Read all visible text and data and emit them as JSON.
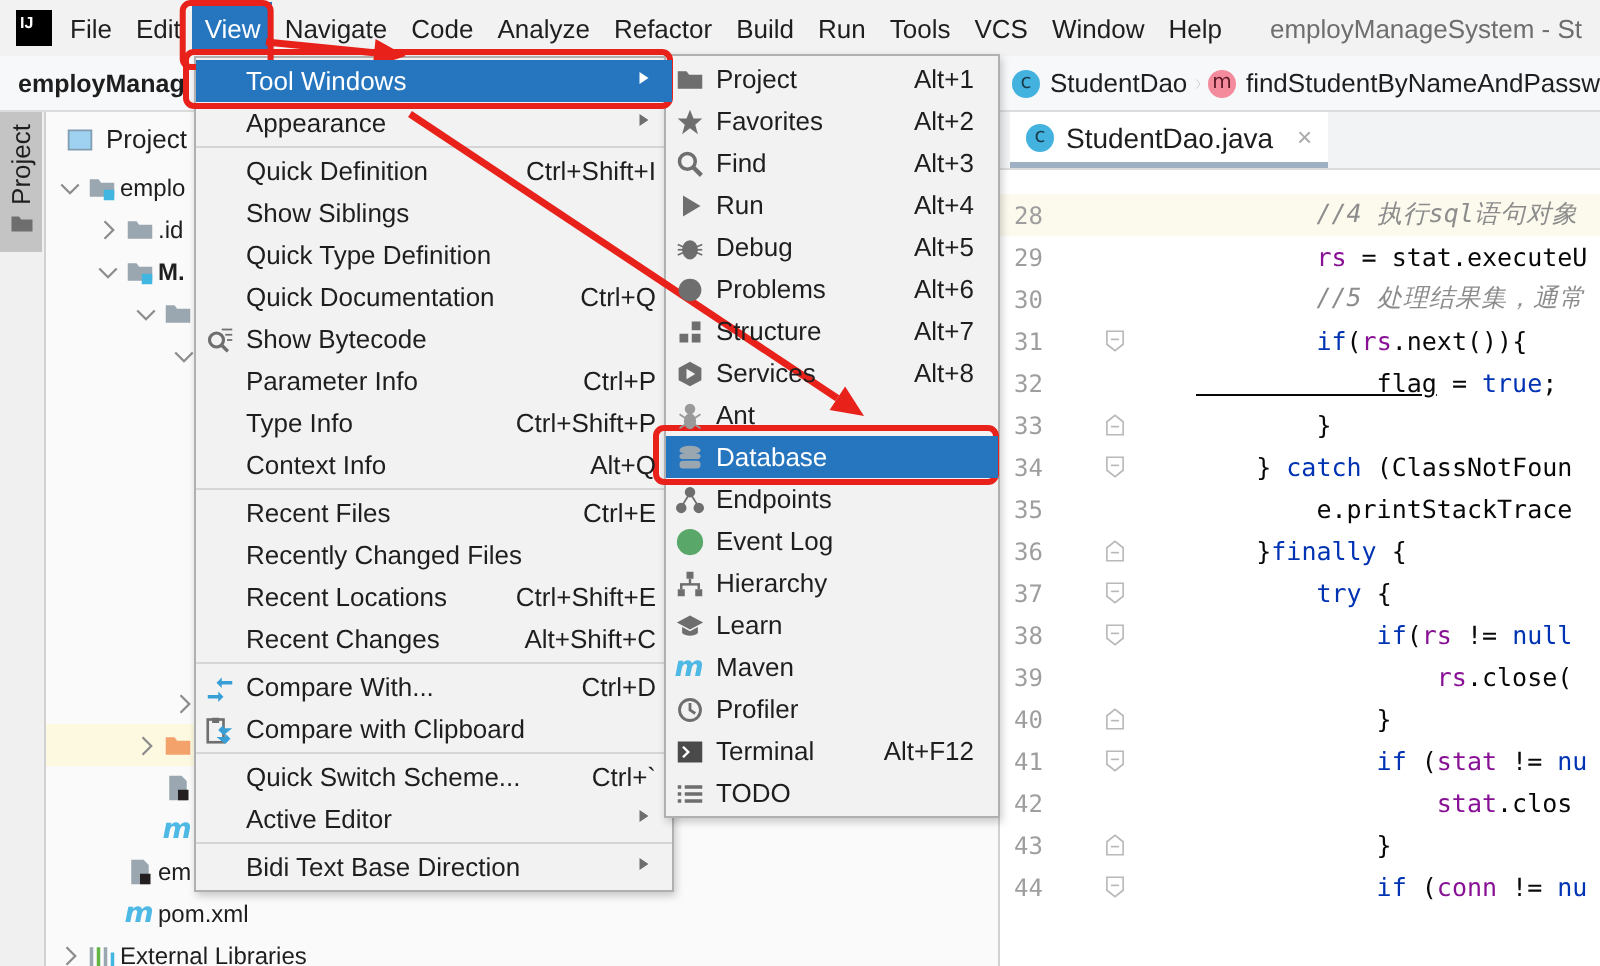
{
  "menubar": {
    "logo_text": "IJ",
    "items": [
      {
        "label": "File",
        "selected": false,
        "outlined": false
      },
      {
        "label": "Edit",
        "selected": false,
        "outlined": false
      },
      {
        "label": "View",
        "selected": true,
        "outlined": true
      },
      {
        "label": "Navigate",
        "selected": false,
        "outlined": false
      },
      {
        "label": "Code",
        "selected": false,
        "outlined": false
      },
      {
        "label": "Analyze",
        "selected": false,
        "outlined": false
      },
      {
        "label": "Refactor",
        "selected": false,
        "outlined": false
      },
      {
        "label": "Build",
        "selected": false,
        "outlined": false
      },
      {
        "label": "Run",
        "selected": false,
        "outlined": false
      },
      {
        "label": "Tools",
        "selected": false,
        "outlined": false
      },
      {
        "label": "VCS",
        "selected": false,
        "outlined": false
      },
      {
        "label": "Window",
        "selected": false,
        "outlined": false
      },
      {
        "label": "Help",
        "selected": false,
        "outlined": false
      }
    ],
    "title": "employManageSystem - St"
  },
  "navbar": {
    "project_name": "employManag"
  },
  "tool_stripe": [
    {
      "label": "Project",
      "selected": true
    }
  ],
  "project_panel": {
    "title": "Project",
    "tree": [
      {
        "label": "emplo",
        "kind": "module",
        "expanded": true,
        "selected": false,
        "children": [
          {
            "label": ".id",
            "kind": "folder",
            "expanded": false,
            "selected": false
          },
          {
            "label": "M.",
            "bold": true,
            "kind": "module",
            "expanded": true,
            "selected": false,
            "children": [
              {
                "kind": "folder",
                "expanded": true,
                "selected": false,
                "children": [
                  {
                    "expanded": true,
                    "selected": false
                  },
                  {
                    "expanded": false,
                    "selected": false
                  }
                ]
              },
              {
                "kind": "folder-orange",
                "expanded": false,
                "selected": true
              },
              {
                "kind": "file",
                "selected": false
              },
              {
                "kind": "maven",
                "icon_glyph": "m",
                "selected": false
              }
            ]
          },
          {
            "label": "em",
            "kind": "file",
            "selected": false
          },
          {
            "label": "pom.xml",
            "kind": "maven",
            "icon_glyph": "m",
            "selected": false
          }
        ]
      },
      {
        "label": "External Libraries",
        "kind": "libraries",
        "expanded": false,
        "selected": false
      }
    ]
  },
  "breadcrumbs": [
    {
      "kind": "class",
      "icon_glyph": "c",
      "label": "StudentDao"
    },
    {
      "kind": "method",
      "icon_glyph": "m",
      "label": "findStudentByNameAndPassw"
    }
  ],
  "editor": {
    "tabs": [
      {
        "label": "StudentDao.java",
        "icon_glyph": "c",
        "close": "×",
        "selected": true
      }
    ],
    "lines": [
      {
        "number": "28",
        "current": true,
        "kind": "plain",
        "segments": [
          {
            "kind": "comment",
            "text": "        //4 执行sql语句对象"
          }
        ]
      },
      {
        "number": "29",
        "current": false,
        "kind": "plain",
        "segments": [
          {
            "kind": "field",
            "text": "        rs"
          },
          {
            "kind": "plain",
            "text": " = stat.executeU"
          }
        ]
      },
      {
        "number": "30",
        "current": false,
        "kind": "plain",
        "segments": [
          {
            "kind": "comment",
            "text": "        //5 处理结果集，通常"
          }
        ]
      },
      {
        "number": "31",
        "current": false,
        "kind": "fold-start",
        "segments": [
          {
            "kind": "keyword",
            "text": "        if"
          },
          {
            "kind": "plain",
            "text": "("
          },
          {
            "kind": "field",
            "text": "rs"
          },
          {
            "kind": "plain",
            "text": ".next()){"
          }
        ]
      },
      {
        "number": "32",
        "current": false,
        "kind": "plain",
        "segments": [
          {
            "kind": "var",
            "text": "            flag"
          },
          {
            "kind": "plain",
            "text": " = "
          },
          {
            "kind": "keyword",
            "text": "true"
          },
          {
            "kind": "plain",
            "text": ";"
          }
        ]
      },
      {
        "number": "33",
        "current": false,
        "kind": "fold-end",
        "segments": [
          {
            "kind": "plain",
            "text": "        }"
          }
        ]
      },
      {
        "number": "34",
        "current": false,
        "kind": "fold-start",
        "segments": [
          {
            "kind": "plain",
            "text": "    } "
          },
          {
            "kind": "keyword",
            "text": "catch"
          },
          {
            "kind": "plain",
            "text": " (ClassNotFoun"
          }
        ]
      },
      {
        "number": "35",
        "current": false,
        "kind": "plain",
        "segments": [
          {
            "kind": "plain",
            "text": "        e.printStackTrace"
          }
        ]
      },
      {
        "number": "36",
        "current": false,
        "kind": "fold-end",
        "segments": [
          {
            "kind": "plain",
            "text": "    }"
          },
          {
            "kind": "keyword",
            "text": "finally"
          },
          {
            "kind": "plain",
            "text": " {"
          }
        ]
      },
      {
        "number": "37",
        "current": false,
        "kind": "fold-start",
        "segments": [
          {
            "kind": "keyword",
            "text": "        try"
          },
          {
            "kind": "plain",
            "text": " {"
          }
        ]
      },
      {
        "number": "38",
        "current": false,
        "kind": "fold-start",
        "segments": [
          {
            "kind": "keyword",
            "text": "            if"
          },
          {
            "kind": "plain",
            "text": "("
          },
          {
            "kind": "field",
            "text": "rs"
          },
          {
            "kind": "plain",
            "text": " != "
          },
          {
            "kind": "keyword",
            "text": "null"
          }
        ]
      },
      {
        "number": "39",
        "current": false,
        "kind": "plain",
        "segments": [
          {
            "kind": "field",
            "text": "                rs"
          },
          {
            "kind": "plain",
            "text": ".close("
          }
        ]
      },
      {
        "number": "40",
        "current": false,
        "kind": "fold-end",
        "segments": [
          {
            "kind": "plain",
            "text": "            }"
          }
        ]
      },
      {
        "number": "41",
        "current": false,
        "kind": "fold-start",
        "segments": [
          {
            "kind": "keyword",
            "text": "            if"
          },
          {
            "kind": "plain",
            "text": " ("
          },
          {
            "kind": "field",
            "text": "stat"
          },
          {
            "kind": "plain",
            "text": " != "
          },
          {
            "kind": "keyword",
            "text": "nu"
          }
        ]
      },
      {
        "number": "42",
        "current": false,
        "kind": "plain",
        "segments": [
          {
            "kind": "field",
            "text": "                stat"
          },
          {
            "kind": "plain",
            "text": ".clos"
          }
        ]
      },
      {
        "number": "43",
        "current": false,
        "kind": "fold-end",
        "segments": [
          {
            "kind": "plain",
            "text": "            }"
          }
        ]
      },
      {
        "number": "44",
        "current": false,
        "kind": "fold-start",
        "segments": [
          {
            "kind": "keyword",
            "text": "            if"
          },
          {
            "kind": "plain",
            "text": " ("
          },
          {
            "kind": "field",
            "text": "conn"
          },
          {
            "kind": "plain",
            "text": " != "
          },
          {
            "kind": "keyword",
            "text": "nu"
          }
        ]
      }
    ]
  },
  "view_menu": {
    "items": [
      {
        "kind": "plain",
        "label": "Tool Windows",
        "submenu": true,
        "selected": true,
        "outlined": true
      },
      {
        "kind": "plain",
        "label": "Appearance",
        "submenu": true,
        "selected": false,
        "outlined": false
      },
      {
        "kind": "separator"
      },
      {
        "kind": "plain",
        "label": "Quick Definition",
        "shortcut": "Ctrl+Shift+I",
        "submenu": false,
        "selected": false,
        "outlined": false
      },
      {
        "kind": "plain",
        "label": "Show Siblings",
        "submenu": false,
        "selected": false,
        "outlined": false
      },
      {
        "kind": "plain",
        "label": "Quick Type Definition",
        "submenu": false,
        "selected": false,
        "outlined": false
      },
      {
        "kind": "plain",
        "label": "Quick Documentation",
        "shortcut": "Ctrl+Q",
        "submenu": false,
        "selected": false,
        "outlined": false
      },
      {
        "kind": "bytecode",
        "label": "Show Bytecode",
        "submenu": false,
        "selected": false,
        "outlined": false
      },
      {
        "kind": "plain",
        "label": "Parameter Info",
        "shortcut": "Ctrl+P",
        "submenu": false,
        "selected": false,
        "outlined": false
      },
      {
        "kind": "plain",
        "label": "Type Info",
        "shortcut": "Ctrl+Shift+P",
        "submenu": false,
        "selected": false,
        "outlined": false
      },
      {
        "kind": "plain",
        "label": "Context Info",
        "shortcut": "Alt+Q",
        "submenu": false,
        "selected": false,
        "outlined": false
      },
      {
        "kind": "separator"
      },
      {
        "kind": "plain",
        "label": "Recent Files",
        "shortcut": "Ctrl+E",
        "submenu": false,
        "selected": false,
        "outlined": false
      },
      {
        "kind": "plain",
        "label": "Recently Changed Files",
        "submenu": false,
        "selected": false,
        "outlined": false
      },
      {
        "kind": "plain",
        "label": "Recent Locations",
        "shortcut": "Ctrl+Shift+E",
        "submenu": false,
        "selected": false,
        "outlined": false
      },
      {
        "kind": "plain",
        "label": "Recent Changes",
        "shortcut": "Alt+Shift+C",
        "submenu": false,
        "selected": false,
        "outlined": false
      },
      {
        "kind": "separator"
      },
      {
        "kind": "compare",
        "label": "Compare With...",
        "shortcut": "Ctrl+D",
        "submenu": false,
        "selected": false,
        "outlined": false
      },
      {
        "kind": "clipboard",
        "label": "Compare with Clipboard",
        "submenu": false,
        "selected": false,
        "outlined": false
      },
      {
        "kind": "separator"
      },
      {
        "kind": "plain",
        "label": "Quick Switch Scheme...",
        "shortcut": "Ctrl+`",
        "submenu": false,
        "selected": false,
        "outlined": false
      },
      {
        "kind": "plain",
        "label": "Active Editor",
        "submenu": true,
        "selected": false,
        "outlined": false
      },
      {
        "kind": "separator"
      },
      {
        "kind": "plain",
        "label": "Bidi Text Base Direction",
        "submenu": true,
        "selected": false,
        "outlined": false
      }
    ]
  },
  "tool_windows_menu": {
    "items": [
      {
        "kind": "folder-dark",
        "label": "Project",
        "shortcut": "Alt+1",
        "selected": false,
        "outlined": false
      },
      {
        "kind": "star",
        "label": "Favorites",
        "shortcut": "Alt+2",
        "selected": false,
        "outlined": false
      },
      {
        "kind": "search",
        "label": "Find",
        "shortcut": "Alt+3",
        "selected": false,
        "outlined": false
      },
      {
        "kind": "play",
        "label": "Run",
        "shortcut": "Alt+4",
        "selected": false,
        "outlined": false
      },
      {
        "kind": "bug",
        "label": "Debug",
        "shortcut": "Alt+5",
        "selected": false,
        "outlined": false
      },
      {
        "kind": "circle",
        "label": "Problems",
        "shortcut": "Alt+6",
        "selected": false,
        "outlined": false
      },
      {
        "kind": "squares",
        "label": "Structure",
        "shortcut": "Alt+7",
        "selected": false,
        "outlined": false
      },
      {
        "kind": "hexagon",
        "label": "Services",
        "shortcut": "Alt+8",
        "selected": false,
        "outlined": false
      },
      {
        "kind": "insect",
        "label": "Ant",
        "selected": false,
        "outlined": false
      },
      {
        "kind": "database",
        "label": "Database",
        "selected": true,
        "outlined": true
      },
      {
        "kind": "nodes",
        "label": "Endpoints",
        "selected": false,
        "outlined": false
      },
      {
        "kind": "dot",
        "label": "Event Log",
        "selected": false,
        "outlined": false
      },
      {
        "kind": "hierarchy",
        "label": "Hierarchy",
        "selected": false,
        "outlined": false
      },
      {
        "kind": "cap",
        "label": "Learn",
        "selected": false,
        "outlined": false
      },
      {
        "kind": "maven",
        "icon_glyph": "m",
        "label": "Maven",
        "selected": false,
        "outlined": false
      },
      {
        "kind": "clock",
        "label": "Profiler",
        "selected": false,
        "outlined": false
      },
      {
        "kind": "terminal",
        "label": "Terminal",
        "shortcut": "Alt+F12",
        "selected": false,
        "outlined": false
      },
      {
        "kind": "list",
        "label": "TODO",
        "selected": false,
        "outlined": false
      }
    ]
  }
}
